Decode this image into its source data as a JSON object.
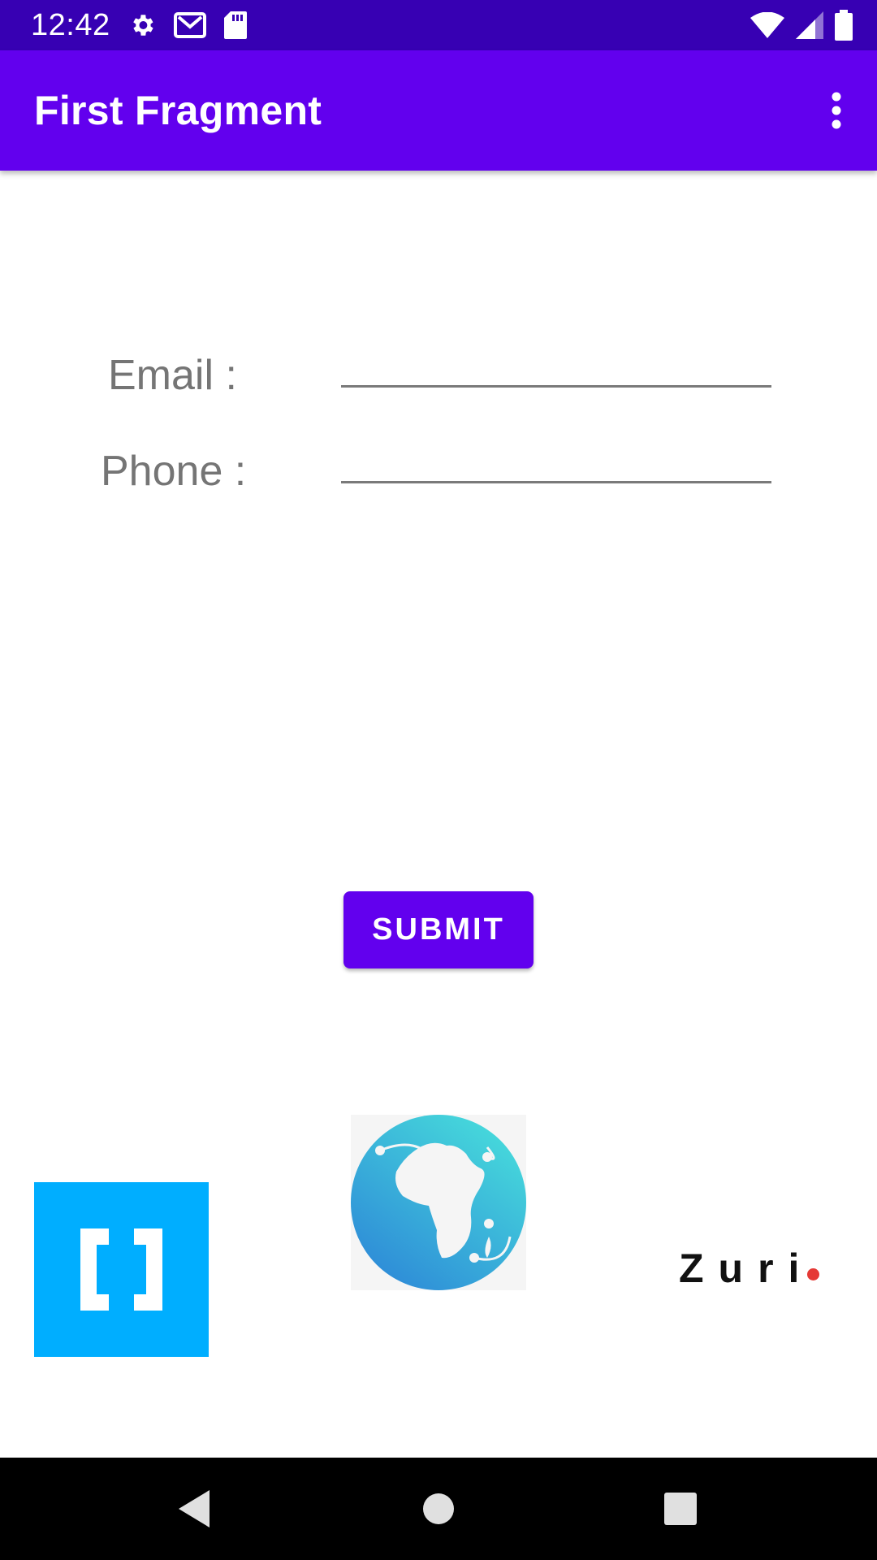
{
  "status_bar": {
    "time": "12:42",
    "left_icons": [
      "settings-icon",
      "gmail-icon",
      "sd-card-icon"
    ],
    "right_icons": [
      "wifi-icon",
      "cell-signal-icon",
      "battery-icon"
    ]
  },
  "app_bar": {
    "title": "First Fragment",
    "overflow_icon": "more-vert-icon"
  },
  "form": {
    "email_label": "Email :",
    "email_value": "",
    "phone_label": "Phone :",
    "phone_value": ""
  },
  "submit_button": {
    "label": "SUBMIT"
  },
  "logos": {
    "left": "brackets-logo",
    "center": "africa-globe-logo",
    "right_text": "Zuri"
  },
  "nav_bar": [
    "back-icon",
    "home-icon",
    "recents-icon"
  ],
  "colors": {
    "status_bar": "#3700b3",
    "primary": "#6200ee",
    "label_gray": "#757575",
    "bracket_blue": "#00aeff",
    "zuri_dot": "#e53935"
  }
}
